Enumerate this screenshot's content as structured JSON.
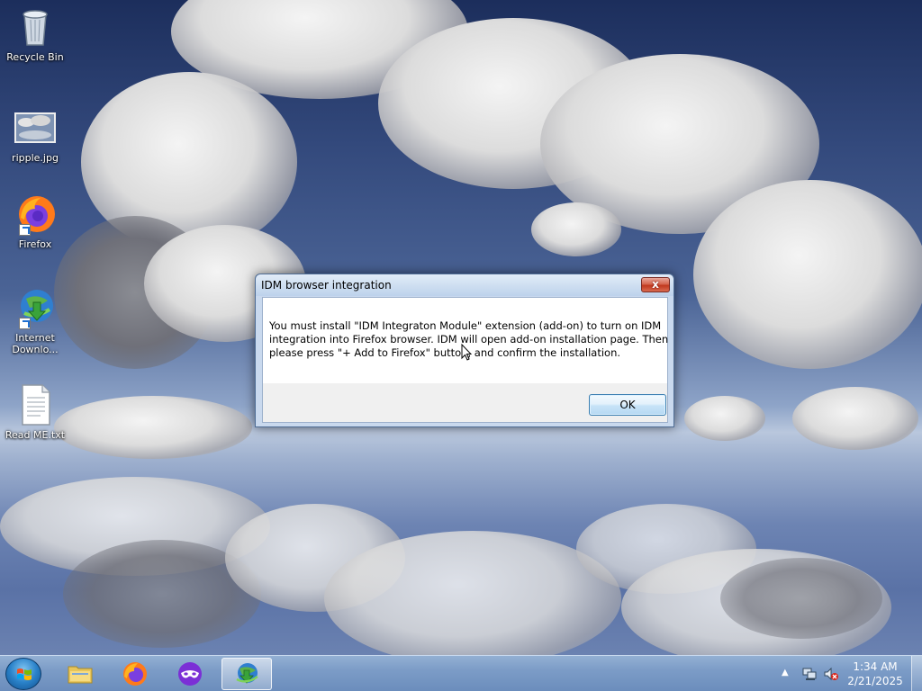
{
  "desktop": {
    "icons": [
      {
        "label": "Recycle Bin",
        "icon": "recycle-bin-icon"
      },
      {
        "label": "ripple.jpg",
        "icon": "image-file-icon"
      },
      {
        "label": "Firefox",
        "icon": "firefox-icon"
      },
      {
        "label": "Internet Downlo...",
        "icon": "idm-icon"
      },
      {
        "label": "Read ME.txt",
        "icon": "text-file-icon"
      }
    ]
  },
  "dialog": {
    "title": "IDM browser integration",
    "close_label": "x",
    "message_lines": [
      "You must install \"IDM Integraton Module\" extension (add-on) to turn on IDM",
      "integration into Firefox browser. IDM will open add-on installation page. Then",
      "please press \"+ Add to Firefox\" button, and confirm the installation."
    ],
    "ok_label": "OK"
  },
  "taskbar": {
    "items": [
      {
        "name": "file-explorer",
        "icon": "folder-icon"
      },
      {
        "name": "firefox",
        "icon": "firefox-icon"
      },
      {
        "name": "firefox-private",
        "icon": "private-browsing-icon"
      },
      {
        "name": "internet-download-manager",
        "icon": "idm-icon",
        "active": true
      }
    ],
    "tray": {
      "chevron": "▲",
      "clock_time": "1:34 AM",
      "clock_date": "2/21/2025"
    }
  },
  "colors": {
    "taskbar": "#7c9cc7",
    "dialog_frame": "#c9d9ee",
    "close_button": "#c0391f",
    "ok_button": "#c7e3f7"
  }
}
